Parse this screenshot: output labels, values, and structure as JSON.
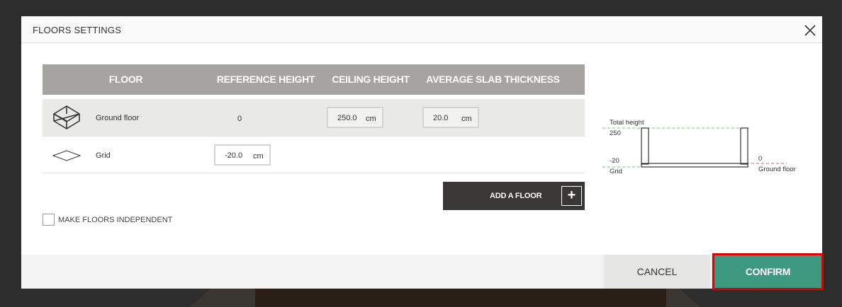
{
  "modal": {
    "title": "FLOORS SETTINGS"
  },
  "table": {
    "headers": [
      "FLOOR",
      "REFERENCE HEIGHT",
      "CEILING HEIGHT",
      "AVERAGE SLAB THICKNESS"
    ],
    "rows": [
      {
        "label": "Ground floor",
        "icon": "cube-icon",
        "reference_height": "0",
        "ceiling_height": "250.0",
        "ceiling_unit": "cm",
        "slab_thickness": "20.0",
        "slab_unit": "cm"
      },
      {
        "label": "Grid",
        "icon": "grid-plane-icon",
        "reference_height": "-20.0",
        "reference_unit": "cm"
      }
    ]
  },
  "actions": {
    "add_floor": "ADD A FLOOR",
    "add_floor_icon": "+",
    "independent_label": "MAKE FLOORS INDEPENDENT"
  },
  "diagram": {
    "total_height_label": "Total height",
    "total_height_value": "250",
    "grid_value": "-20",
    "grid_label": "Grid",
    "ground_value": "0",
    "ground_label": "Ground floor"
  },
  "footer": {
    "cancel": "CANCEL",
    "confirm": "CONFIRM"
  },
  "colors": {
    "confirm": "#3d9980",
    "header": "#a5a4a0",
    "add_floor": "#3a3836",
    "highlight": "#e00000"
  }
}
